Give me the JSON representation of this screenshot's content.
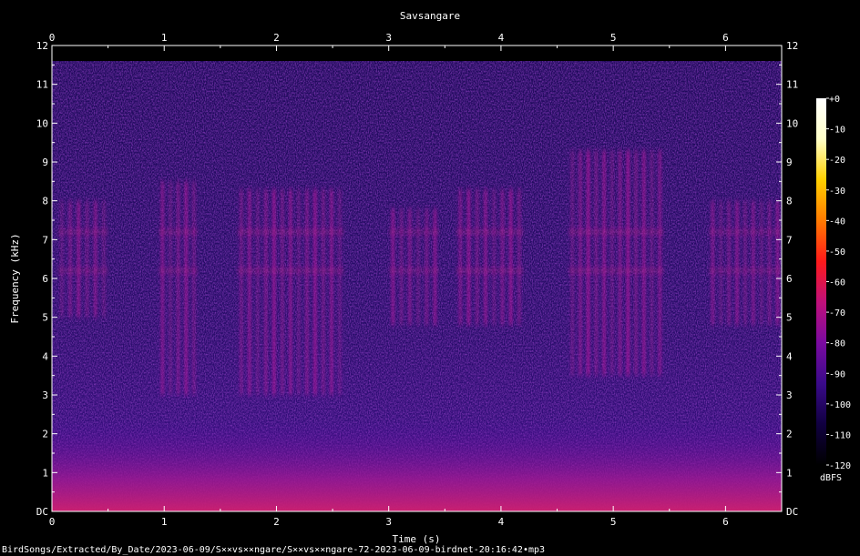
{
  "chart_data": {
    "type": "heatmap",
    "title": "Savsangare",
    "xlabel": "Time (s)",
    "ylabel": "Frequency (kHz)",
    "x_ticks": [
      "0",
      "1",
      "2",
      "3",
      "4",
      "5",
      "6"
    ],
    "xlim": [
      0,
      6.5
    ],
    "y_ticks": [
      "DC",
      "1",
      "2",
      "3",
      "4",
      "5",
      "6",
      "7",
      "8",
      "9",
      "10",
      "11",
      "12"
    ],
    "ylim": [
      0,
      12
    ],
    "colorbar": {
      "label": "dBFS",
      "ticks": [
        "+0",
        "-10",
        "-20",
        "-30",
        "-40",
        "-50",
        "-60",
        "-70",
        "-80",
        "-90",
        "-100",
        "-110",
        "-120"
      ],
      "range": [
        -120,
        0
      ],
      "colormap": [
        "#000000",
        "#100040",
        "#3a0a8a",
        "#7a0aa0",
        "#c0107a",
        "#ff1a1a",
        "#ff7a00",
        "#ffd000",
        "#ffffc8",
        "#ffffff"
      ]
    },
    "background_level_dbfs": -105,
    "low_frequency_band": {
      "freq_khz": [
        0,
        1.2
      ],
      "level_dbfs": -72
    },
    "song_bursts": [
      {
        "t_start": 0.05,
        "t_end": 0.5,
        "freq_khz": [
          5.0,
          8.0
        ],
        "level_dbfs": -78
      },
      {
        "t_start": 0.95,
        "t_end": 1.3,
        "freq_khz": [
          3.0,
          8.5
        ],
        "level_dbfs": -78
      },
      {
        "t_start": 1.65,
        "t_end": 2.6,
        "freq_khz": [
          3.0,
          8.3
        ],
        "level_dbfs": -76
      },
      {
        "t_start": 3.0,
        "t_end": 3.45,
        "freq_khz": [
          4.8,
          7.8
        ],
        "level_dbfs": -80
      },
      {
        "t_start": 3.6,
        "t_end": 4.2,
        "freq_khz": [
          4.8,
          8.3
        ],
        "level_dbfs": -76
      },
      {
        "t_start": 4.6,
        "t_end": 5.45,
        "freq_khz": [
          3.5,
          9.3
        ],
        "level_dbfs": -74
      },
      {
        "t_start": 5.85,
        "t_end": 6.5,
        "freq_khz": [
          4.8,
          8.0
        ],
        "level_dbfs": -80
      }
    ],
    "grid": false
  },
  "footer": {
    "path": "BirdSongs/Extracted/By_Date/2023-06-09/S××vs××ngare/S××vs××ngare-72-2023-06-09-birdnet-20:16:42∙mp3"
  }
}
